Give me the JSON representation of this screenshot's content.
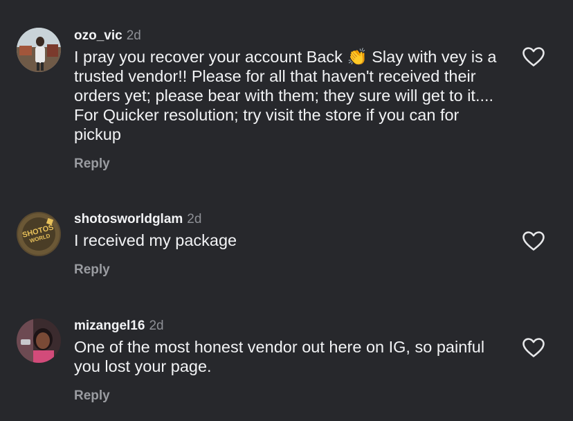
{
  "comments": [
    {
      "username": "ozo_vic",
      "time": "2d",
      "text": "I pray you recover your account Back 👏 Slay with vey is a trusted vendor!! Please for all that haven't received their orders yet; please bear with them; they sure will get to it.... For Quicker resolution; try visit the store if you can for pickup",
      "reply_label": "Reply",
      "avatar_icon": "profile-photo"
    },
    {
      "username": "shotosworldglam",
      "time": "2d",
      "text": "I received my package",
      "reply_label": "Reply",
      "avatar_icon": "brand-logo"
    },
    {
      "username": "mizangel16",
      "time": "2d",
      "text": "One of the most honest vendor out here on IG, so painful you lost your page.",
      "reply_label": "Reply",
      "avatar_icon": "profile-photo"
    }
  ],
  "logos": {
    "shotos_line1": "SHOTOS",
    "shotos_line2": "WORLD"
  },
  "colors": {
    "background": "#27282c",
    "text": "#f2f3f5",
    "secondary": "#8e9096"
  }
}
